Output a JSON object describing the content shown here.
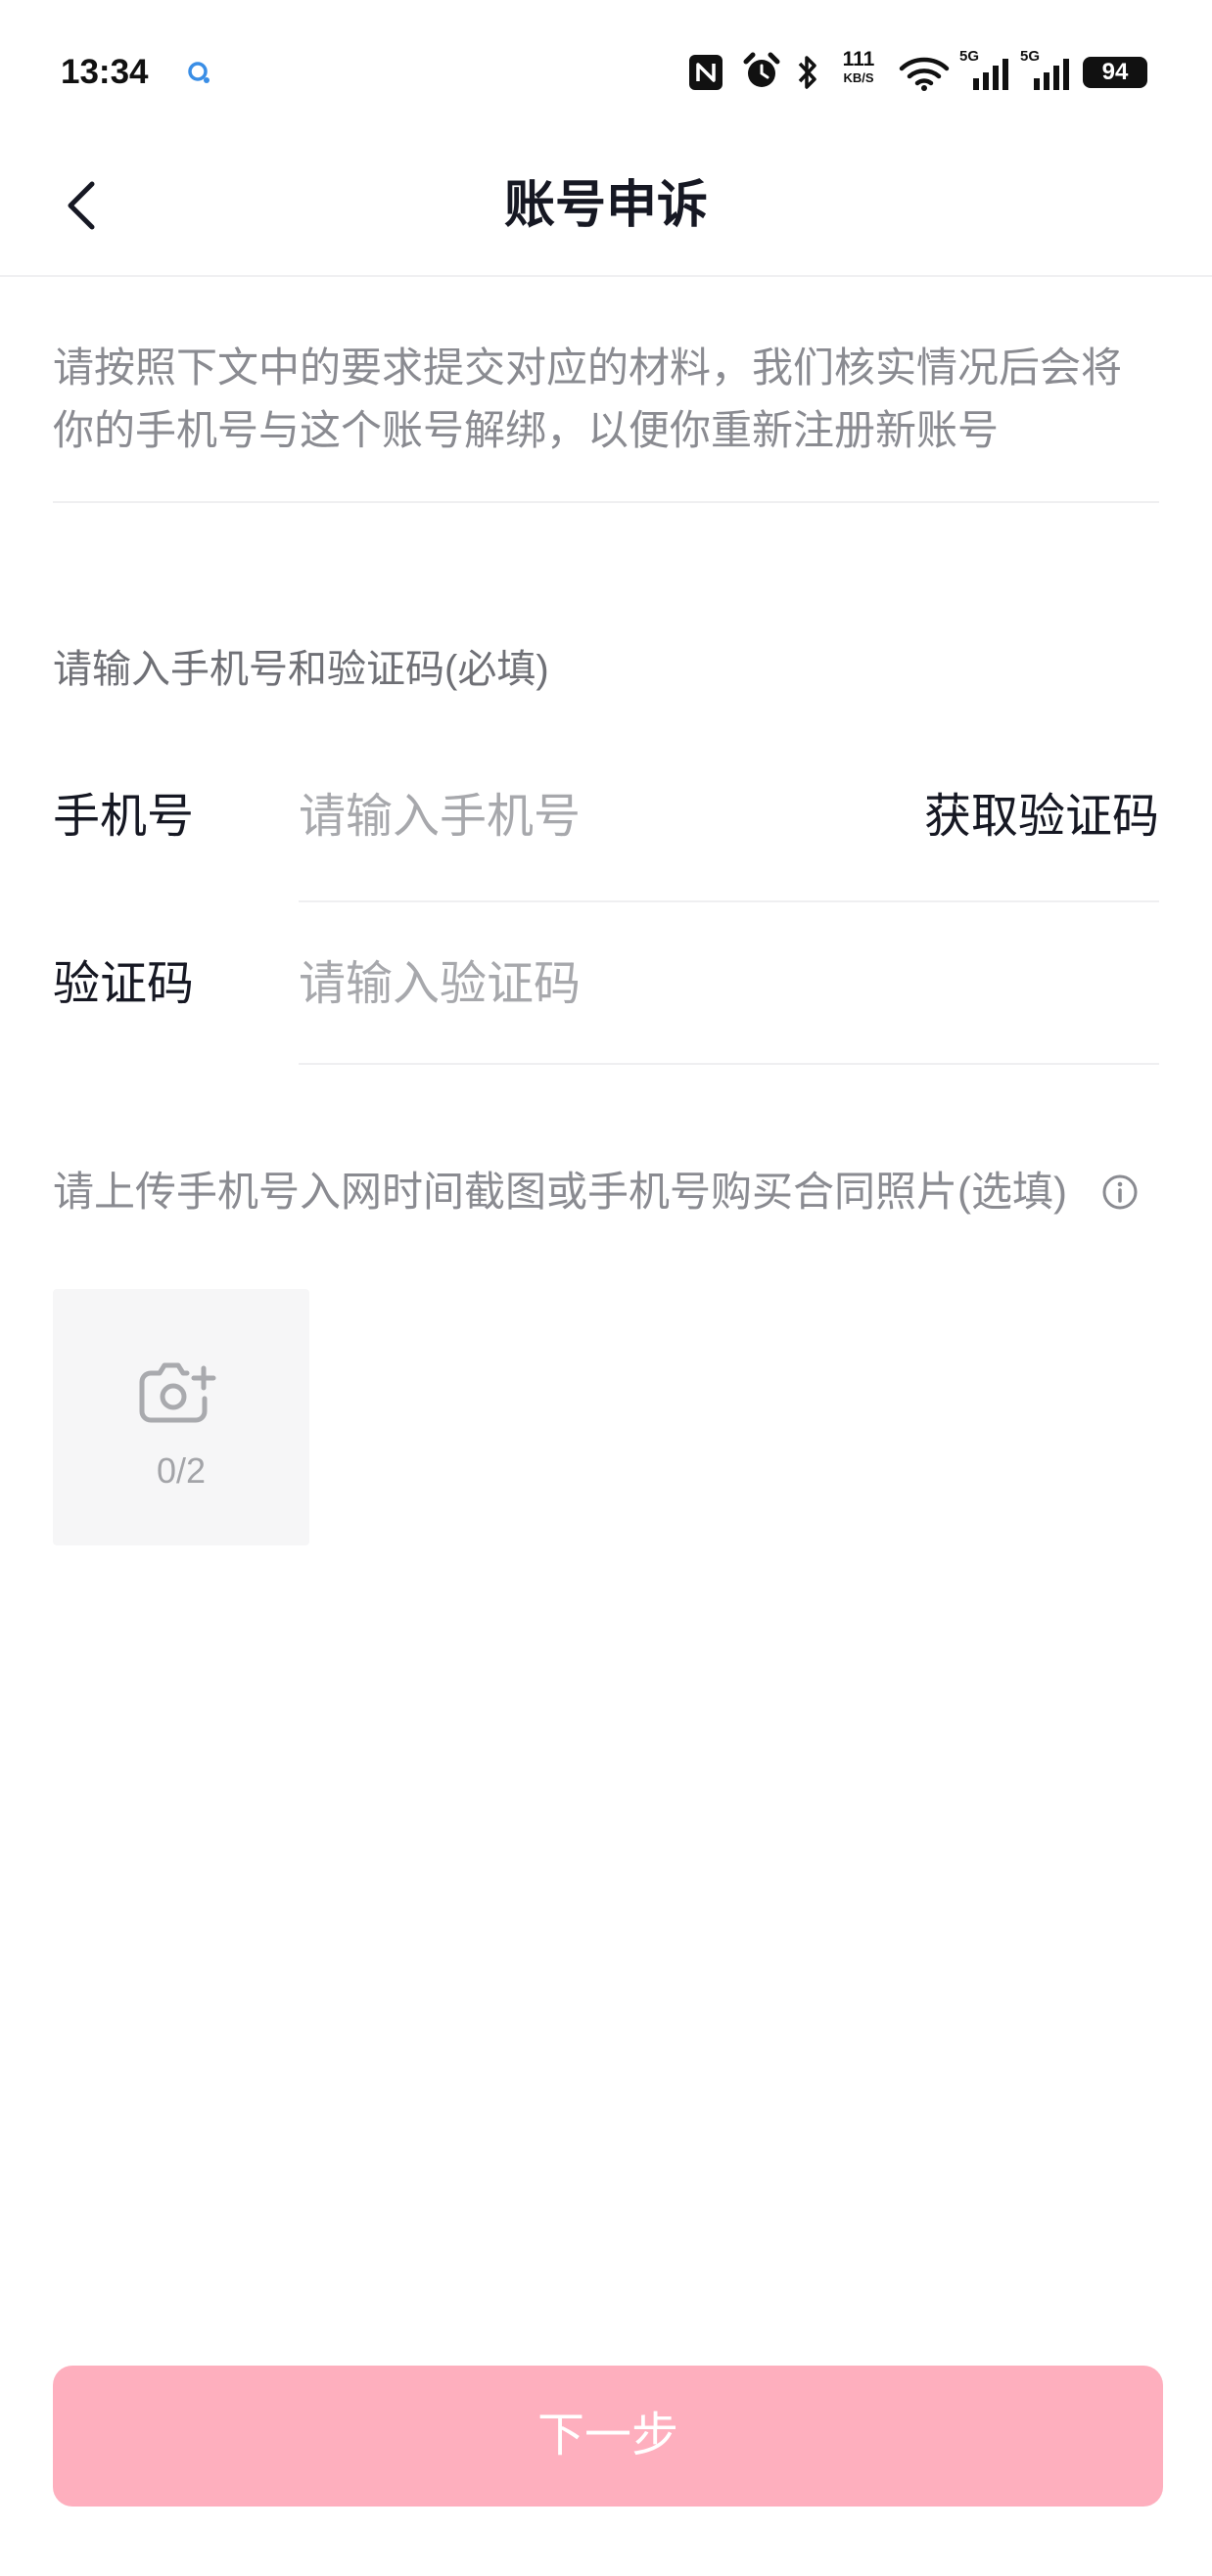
{
  "status_bar": {
    "time": "13:34",
    "notification_icon": "app-notification-icon",
    "net_speed": {
      "value": "111",
      "unit": "KB/S"
    },
    "signal_sim1": {
      "label": "5G"
    },
    "signal_sim2": {
      "label": "5G"
    },
    "battery_level": "94",
    "icons": [
      "nfc-icon",
      "alarm-icon",
      "bluetooth-icon",
      "wifi-icon",
      "signal-icon",
      "signal-icon",
      "battery-icon"
    ]
  },
  "header": {
    "title": "账号申诉",
    "back_icon": "chevron-left-icon"
  },
  "intro": {
    "lines": [
      "请按照下文中的要求提交对应的材料，我们核实情况后会将",
      "你的手机号与这个账号解绑，以便你重新注册新账号"
    ]
  },
  "phone_section": {
    "label": "请输入手机号和验证码(必填)",
    "phone_field": {
      "label": "手机号",
      "placeholder": "请输入手机号",
      "get_code_label": "获取验证码"
    },
    "code_field": {
      "label": "验证码",
      "placeholder": "请输入验证码"
    }
  },
  "upload_section": {
    "label": "请上传手机号入网时间截图或手机号购买合同照片(选填)",
    "info_icon": "info-icon",
    "upload_icon": "camera-add-icon",
    "count": "0/2"
  },
  "next_button": {
    "label": "下一步",
    "state": "disabled"
  },
  "colors": {
    "button_disabled": "#FEAFBE",
    "text_primary": "#161823",
    "text_secondary": "#8A8B91",
    "placeholder": "#A7A8AC",
    "divider": "#EFEFF1",
    "upload_bg": "#F6F6F7"
  }
}
